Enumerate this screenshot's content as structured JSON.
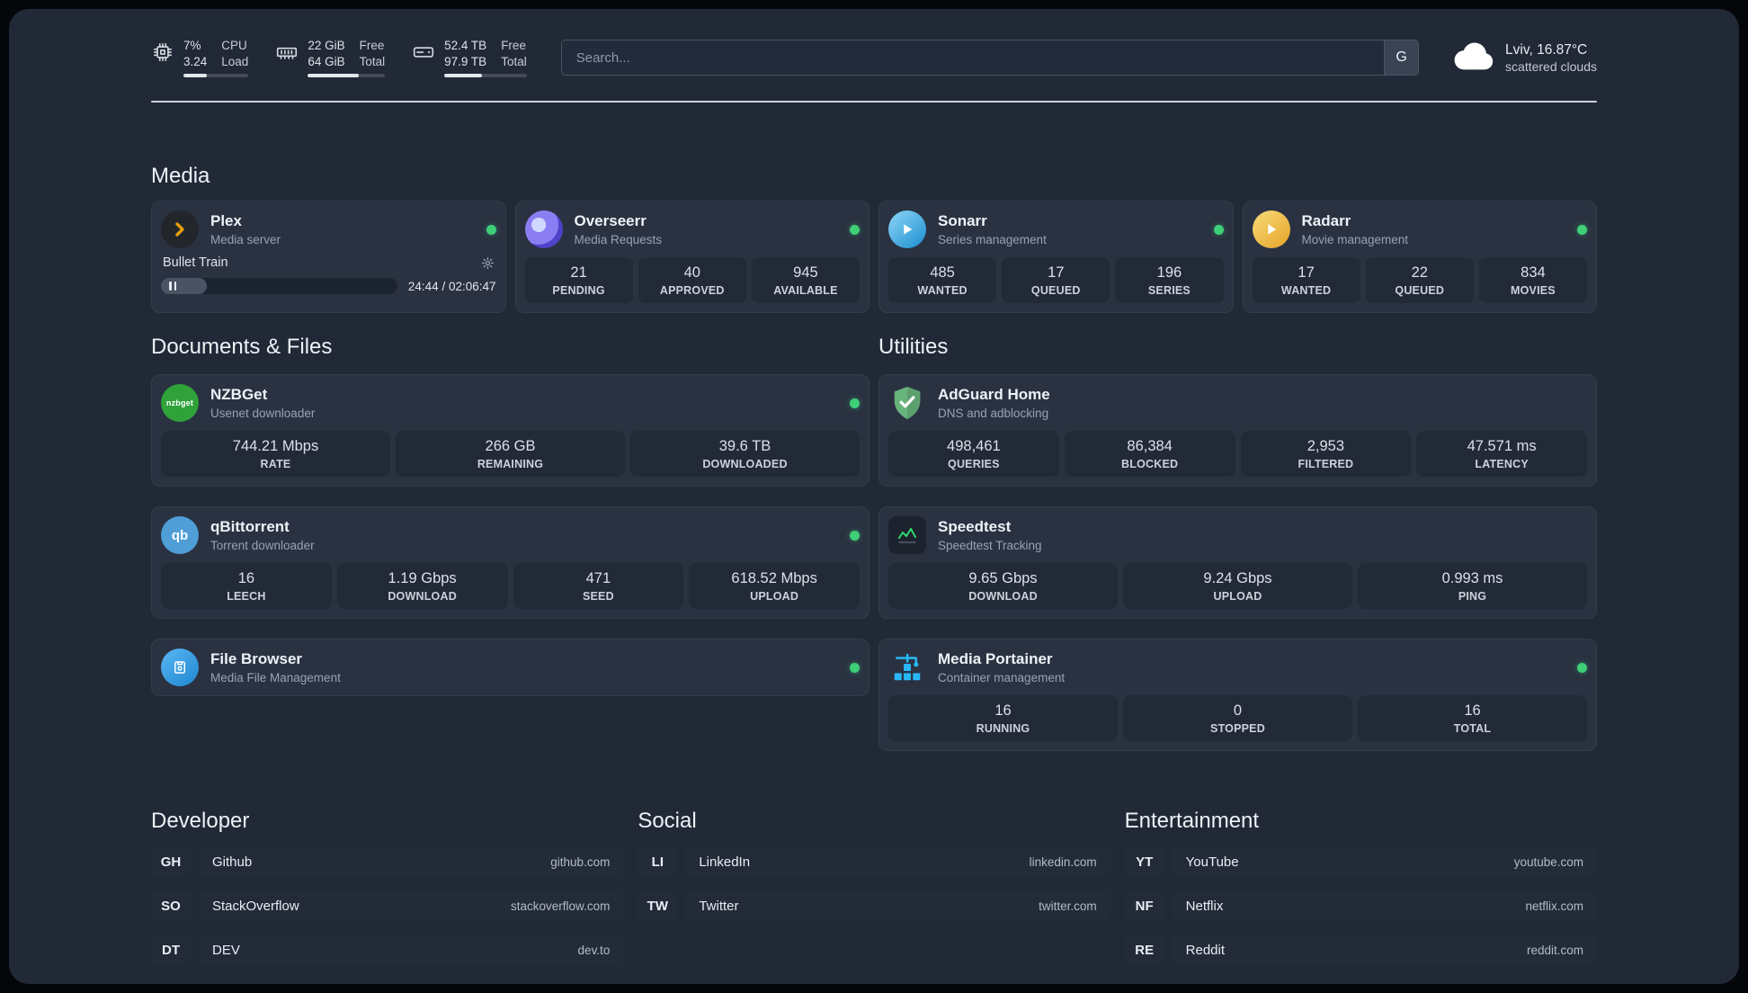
{
  "colors": {
    "status_online": "#3ecf77",
    "panel_background": "#212937",
    "card_background": "#2a3242",
    "tile_background": "#222a38",
    "divider": "#ccd2da",
    "plex_accent": "#e5a00d",
    "sonarr_accent": "#35a7e0",
    "radarr_accent": "#eeb02c",
    "overseerr_accent": "#8b7df2",
    "nzbget_accent": "#2fa23a",
    "qbittorrent_accent": "#4f9ed8",
    "filebrowser_accent": "#2f9de4",
    "adguard_accent": "#68b27c",
    "speedtest_accent": "#2bd96e",
    "portainer_accent": "#29b8f5"
  },
  "icons": {
    "cpu": "chip",
    "ram": "memory-stick",
    "disk": "hard-drive",
    "weather": "cloud",
    "plex": "chevron-right",
    "sonarr": "play-triangle",
    "radarr": "play-triangle",
    "adguard": "shield-check",
    "speedtest": "line-chart",
    "portainer": "container-crane"
  },
  "topbar": {
    "cpu": {
      "percent": "7%",
      "load": "3.24",
      "label_top": "CPU",
      "label_bottom": "Load",
      "bar_percent": 36
    },
    "ram": {
      "free": "22 GiB",
      "label_top": "Free",
      "total": "64 GiB",
      "label_bottom": "Total",
      "bar_percent": 66
    },
    "disk": {
      "free": "52.4 TB",
      "label_top": "Free",
      "total": "97.9 TB",
      "label_bottom": "Total",
      "bar_percent": 46
    },
    "search": {
      "placeholder": "Search...",
      "engine_button": "G"
    },
    "weather": {
      "location": "Lviv, 16.87°C",
      "condition": "scattered clouds"
    }
  },
  "sections": {
    "media": {
      "title": "Media",
      "plex": {
        "name": "Plex",
        "subtitle": "Media server",
        "now_playing": {
          "title": "Bullet Train",
          "time": "24:44 / 02:06:47",
          "progress_percent": 19.5
        }
      },
      "overseerr": {
        "name": "Overseerr",
        "subtitle": "Media Requests",
        "stats": [
          {
            "value": "21",
            "label": "PENDING"
          },
          {
            "value": "40",
            "label": "APPROVED"
          },
          {
            "value": "945",
            "label": "AVAILABLE"
          }
        ]
      },
      "sonarr": {
        "name": "Sonarr",
        "subtitle": "Series management",
        "stats": [
          {
            "value": "485",
            "label": "WANTED"
          },
          {
            "value": "17",
            "label": "QUEUED"
          },
          {
            "value": "196",
            "label": "SERIES"
          }
        ]
      },
      "radarr": {
        "name": "Radarr",
        "subtitle": "Movie management",
        "stats": [
          {
            "value": "17",
            "label": "WANTED"
          },
          {
            "value": "22",
            "label": "QUEUED"
          },
          {
            "value": "834",
            "label": "MOVIES"
          }
        ]
      }
    },
    "documents": {
      "title": "Documents & Files",
      "nzbget": {
        "name": "NZBGet",
        "subtitle": "Usenet downloader",
        "icon_text": "nzbget",
        "stats": [
          {
            "value": "744.21 Mbps",
            "label": "RATE"
          },
          {
            "value": "266 GB",
            "label": "REMAINING"
          },
          {
            "value": "39.6 TB",
            "label": "DOWNLOADED"
          }
        ]
      },
      "qbittorrent": {
        "name": "qBittorrent",
        "subtitle": "Torrent downloader",
        "icon_text": "qb",
        "stats": [
          {
            "value": "16",
            "label": "LEECH"
          },
          {
            "value": "1.19 Gbps",
            "label": "DOWNLOAD"
          },
          {
            "value": "471",
            "label": "SEED"
          },
          {
            "value": "618.52 Mbps",
            "label": "UPLOAD"
          }
        ]
      },
      "filebrowser": {
        "name": "File Browser",
        "subtitle": "Media File Management"
      }
    },
    "utilities": {
      "title": "Utilities",
      "adguard": {
        "name": "AdGuard Home",
        "subtitle": "DNS and adblocking",
        "stats": [
          {
            "value": "498,461",
            "label": "QUERIES"
          },
          {
            "value": "86,384",
            "label": "BLOCKED"
          },
          {
            "value": "2,953",
            "label": "FILTERED"
          },
          {
            "value": "47.571 ms",
            "label": "LATENCY"
          }
        ]
      },
      "speedtest": {
        "name": "Speedtest",
        "subtitle": "Speedtest Tracking",
        "stats": [
          {
            "value": "9.65 Gbps",
            "label": "DOWNLOAD"
          },
          {
            "value": "9.24 Gbps",
            "label": "UPLOAD"
          },
          {
            "value": "0.993 ms",
            "label": "PING"
          }
        ]
      },
      "portainer": {
        "name": "Media Portainer",
        "subtitle": "Container management",
        "stats": [
          {
            "value": "16",
            "label": "RUNNING"
          },
          {
            "value": "0",
            "label": "STOPPED"
          },
          {
            "value": "16",
            "label": "TOTAL"
          }
        ]
      }
    },
    "bookmarks": {
      "developer": {
        "title": "Developer",
        "items": [
          {
            "abbr": "GH",
            "name": "Github",
            "domain": "github.com"
          },
          {
            "abbr": "SO",
            "name": "StackOverflow",
            "domain": "stackoverflow.com"
          },
          {
            "abbr": "DT",
            "name": "DEV",
            "domain": "dev.to"
          }
        ]
      },
      "social": {
        "title": "Social",
        "items": [
          {
            "abbr": "LI",
            "name": "LinkedIn",
            "domain": "linkedin.com"
          },
          {
            "abbr": "TW",
            "name": "Twitter",
            "domain": "twitter.com"
          }
        ]
      },
      "entertainment": {
        "title": "Entertainment",
        "items": [
          {
            "abbr": "YT",
            "name": "YouTube",
            "domain": "youtube.com"
          },
          {
            "abbr": "NF",
            "name": "Netflix",
            "domain": "netflix.com"
          },
          {
            "abbr": "RE",
            "name": "Reddit",
            "domain": "reddit.com"
          }
        ]
      }
    }
  }
}
